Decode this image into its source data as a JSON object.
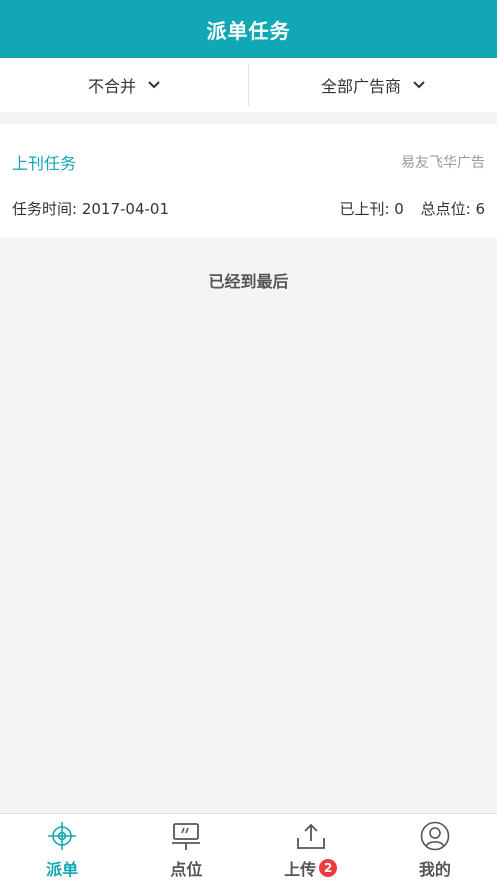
{
  "header": {
    "title": "派单任务"
  },
  "filters": [
    {
      "label": "不合并",
      "icon": "chevron-down-icon"
    },
    {
      "label": "全部广告商",
      "icon": "chevron-down-icon"
    }
  ],
  "task": {
    "type": "上刊任务",
    "advertiser": "易友飞华广告",
    "time": "任务时间: 2017-04-01",
    "published": "已上刊: 0",
    "total": "总点位: 6"
  },
  "list_end": "已经到最后",
  "tabs": [
    {
      "label": "派单",
      "icon": "crosshair-icon",
      "active": true
    },
    {
      "label": "点位",
      "icon": "billboard-icon",
      "active": false
    },
    {
      "label": "上传",
      "icon": "upload-icon",
      "active": false,
      "badge": "2"
    },
    {
      "label": "我的",
      "icon": "user-icon",
      "active": false
    }
  ],
  "colors": {
    "accent": "#11a8b5",
    "badge": "#ee3b3b"
  }
}
